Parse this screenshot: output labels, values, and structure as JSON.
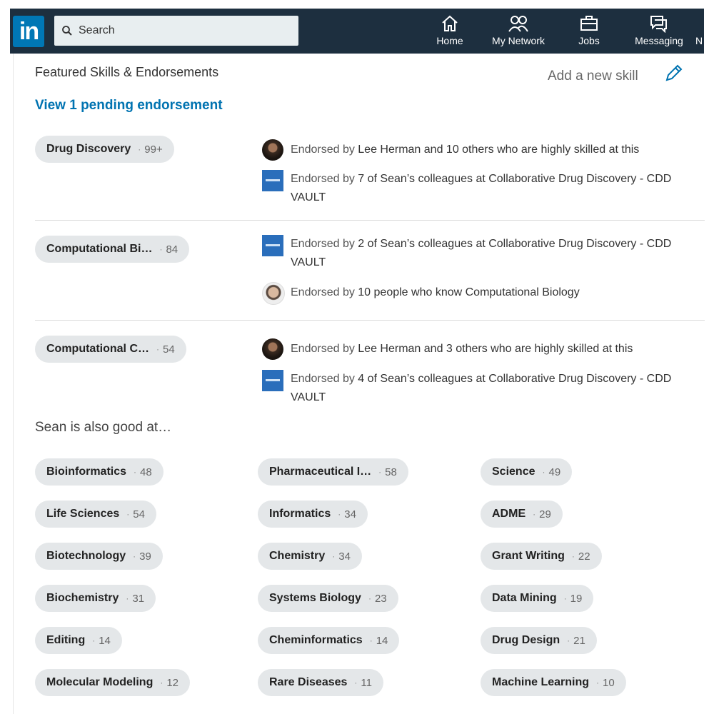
{
  "nav": {
    "logo": "in",
    "search_placeholder": "Search",
    "items": [
      {
        "label": "Home"
      },
      {
        "label": "My Network"
      },
      {
        "label": "Jobs"
      },
      {
        "label": "Messaging"
      },
      {
        "label": "N"
      }
    ]
  },
  "section": {
    "title": "Featured Skills & Endorsements",
    "add_skill": "Add a new skill",
    "pending": "View 1 pending endorsement"
  },
  "featured": [
    {
      "name": "Drug Discovery",
      "count": "99+",
      "endorsements": [
        {
          "pre": "Endorsed by ",
          "strong": "Lee Herman and 10 others who are highly skilled at this",
          "icon": "person-avatar-icon"
        },
        {
          "pre": "Endorsed by ",
          "strong": "7 of Sean’s colleagues at Collaborative Drug Discovery - CDD VAULT",
          "icon": "company-logo-icon"
        }
      ]
    },
    {
      "name": "Computational Bi…",
      "count": "84",
      "endorsements": [
        {
          "pre": "Endorsed by ",
          "strong": "2 of Sean’s colleagues at Collaborative Drug Discovery - CDD VAULT",
          "icon": "company-logo-icon"
        },
        {
          "pre": "Endorsed by ",
          "strong": "10 people who know Computational Biology",
          "icon": "person-avatar-icon"
        }
      ]
    },
    {
      "name": "Computational C…",
      "count": "54",
      "endorsements": [
        {
          "pre": "Endorsed by ",
          "strong": "Lee Herman and 3 others who are highly skilled at this",
          "icon": "person-avatar-icon"
        },
        {
          "pre": "Endorsed by ",
          "strong": "4 of Sean’s colleagues at Collaborative Drug Discovery - CDD VAULT",
          "icon": "company-logo-icon"
        }
      ]
    }
  ],
  "also_title": "Sean is also good at…",
  "other_skills": [
    {
      "name": "Bioinformatics",
      "count": "48"
    },
    {
      "name": "Pharmaceutical I…",
      "count": "58"
    },
    {
      "name": "Science",
      "count": "49"
    },
    {
      "name": "Life Sciences",
      "count": "54"
    },
    {
      "name": "Informatics",
      "count": "34"
    },
    {
      "name": "ADME",
      "count": "29"
    },
    {
      "name": "Biotechnology",
      "count": "39"
    },
    {
      "name": "Chemistry",
      "count": "34"
    },
    {
      "name": "Grant Writing",
      "count": "22"
    },
    {
      "name": "Biochemistry",
      "count": "31"
    },
    {
      "name": "Systems Biology",
      "count": "23"
    },
    {
      "name": "Data Mining",
      "count": "19"
    },
    {
      "name": "Editing",
      "count": "14"
    },
    {
      "name": "Cheminformatics",
      "count": "14"
    },
    {
      "name": "Drug Design",
      "count": "21"
    },
    {
      "name": "Molecular Modeling",
      "count": "12"
    },
    {
      "name": "Rare Diseases",
      "count": "11"
    },
    {
      "name": "Machine Learning",
      "count": "10"
    }
  ],
  "colors": {
    "nav_bg": "#1d2f3f",
    "brand": "#0077b5",
    "link": "#0073b1",
    "pill_bg": "#e4e7e9"
  }
}
